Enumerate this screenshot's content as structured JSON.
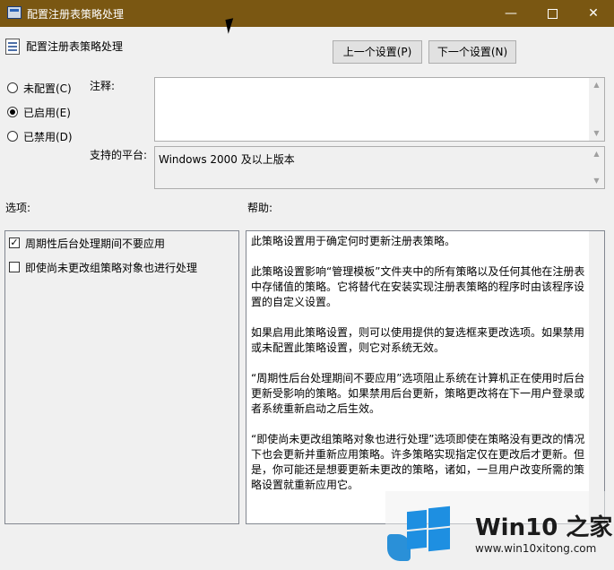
{
  "window": {
    "title": "配置注册表策略处理",
    "min_glyph": "—",
    "close_glyph": "✕",
    "titlebar_color": "#7a5712"
  },
  "header": {
    "policy_title": "配置注册表策略处理",
    "prev_label": "上一个设置(P)",
    "next_label": "下一个设置(N)"
  },
  "state": {
    "options": [
      {
        "label": "未配置(C)",
        "selected": false
      },
      {
        "label": "已启用(E)",
        "selected": true
      },
      {
        "label": "已禁用(D)",
        "selected": false
      }
    ]
  },
  "comment": {
    "label": "注释:",
    "value": ""
  },
  "platform": {
    "label": "支持的平台:",
    "value": "Windows 2000 及以上版本"
  },
  "options_section": {
    "label": "选项:",
    "items": [
      {
        "label": "周期性后台处理期间不要应用",
        "checked": true
      },
      {
        "label": "即使尚未更改组策略对象也进行处理",
        "checked": false
      }
    ]
  },
  "help_section": {
    "label": "帮助:",
    "paragraphs": [
      "此策略设置用于确定何时更新注册表策略。",
      "此策略设置影响“管理模板”文件夹中的所有策略以及任何其他在注册表中存储值的策略。它将替代在安装实现注册表策略的程序时由该程序设置的自定义设置。",
      "如果启用此策略设置，则可以使用提供的复选框来更改选项。如果禁用或未配置此策略设置，则它对系统无效。",
      "“周期性后台处理期间不要应用”选项阻止系统在计算机正在使用时后台更新受影响的策略。如果禁用后台更新，策略更改将在下一用户登录或者系统重新启动之后生效。",
      "“即使尚未更改组策略对象也进行处理”选项即使在策略没有更改的情况下也会更新并重新应用策略。许多策略实现指定仅在更改后才更新。但是，你可能还是想要更新未更改的策略，诸如，一旦用户改变所需的策略设置就重新应用它。"
    ]
  },
  "watermark": {
    "title": "Win10 之家",
    "url": "www.win10xitong.com",
    "color": "#1e8fe1"
  }
}
